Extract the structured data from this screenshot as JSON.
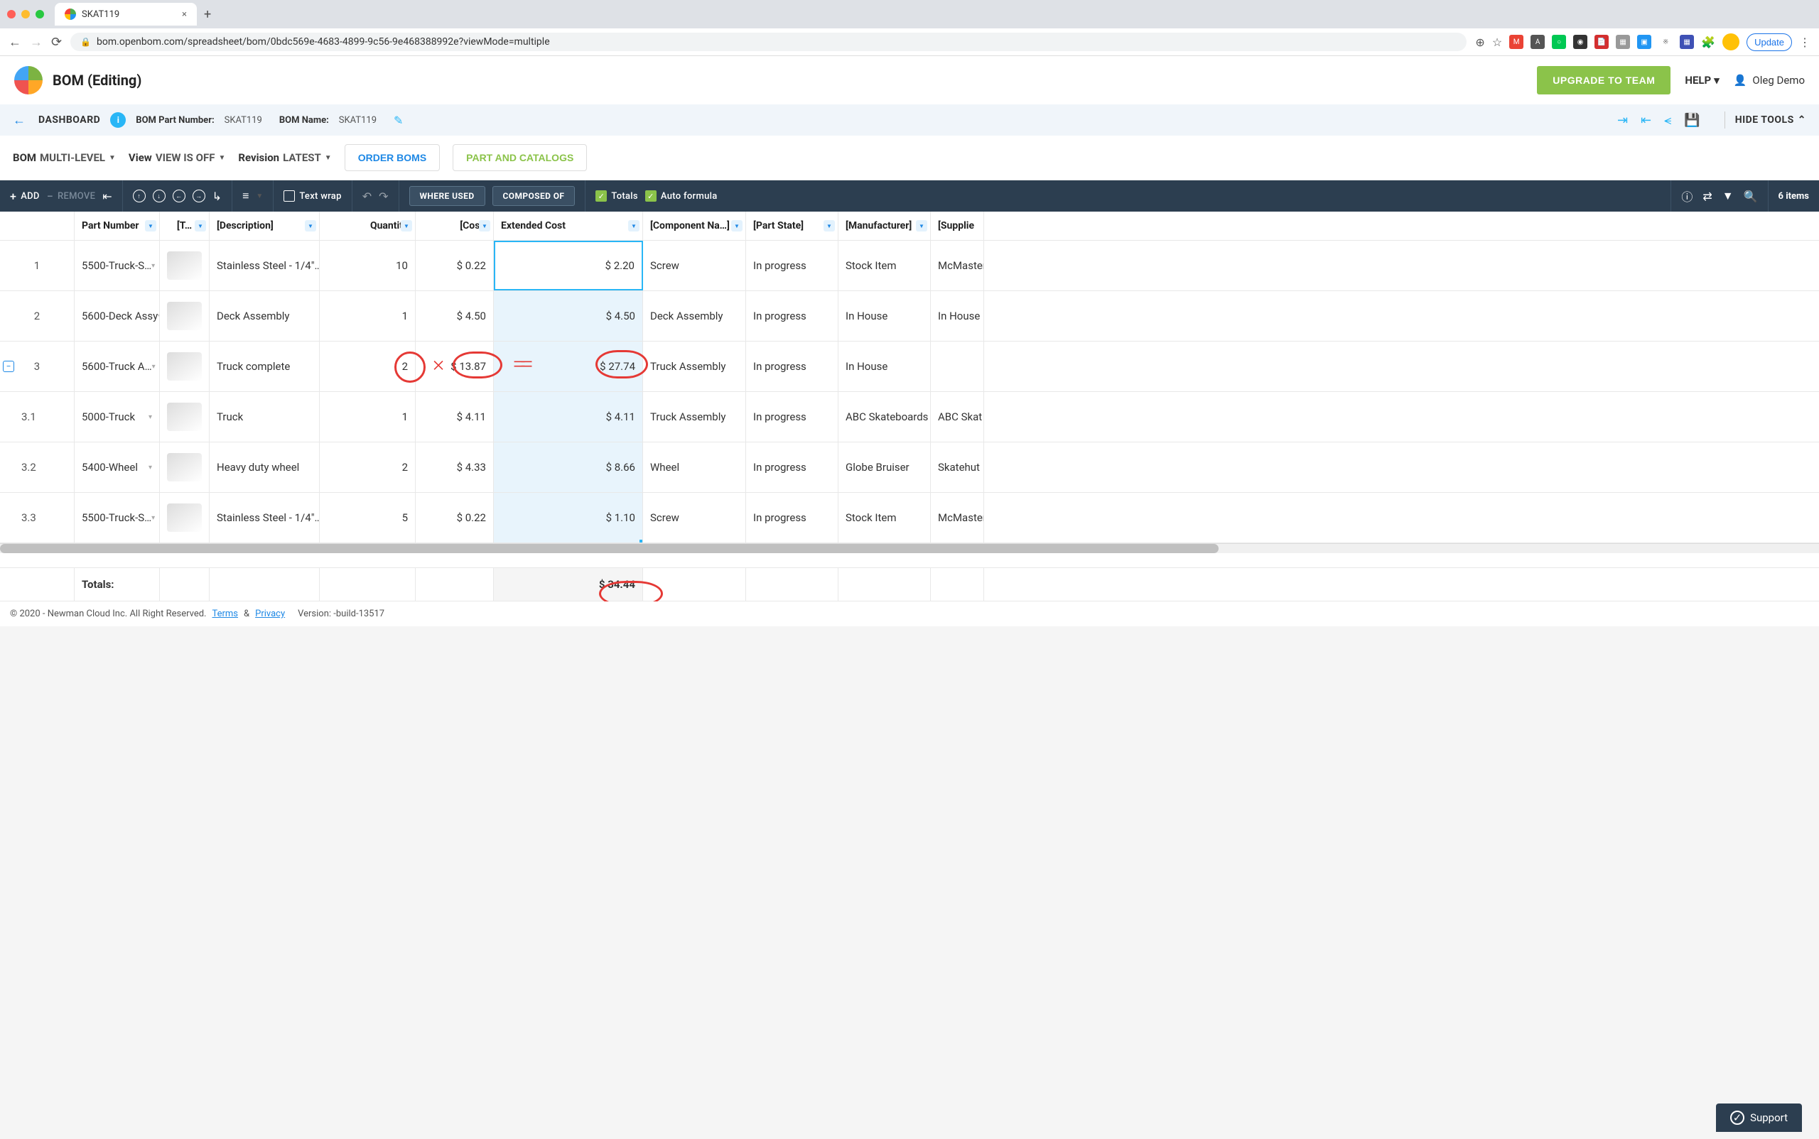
{
  "browser": {
    "tab_title": "SKAT119",
    "url": "bom.openbom.com/spreadsheet/bom/0bdc569e-4683-4899-9c56-9e468388992e?viewMode=multiple",
    "update_btn": "Update"
  },
  "header": {
    "title": "BOM (Editing)",
    "upgrade": "UPGRADE TO TEAM",
    "help": "HELP",
    "user": "Oleg Demo"
  },
  "subheader": {
    "dashboard": "DASHBOARD",
    "pn_label": "BOM Part Number:",
    "pn_val": "SKAT119",
    "name_label": "BOM Name:",
    "name_val": "SKAT119",
    "hide_tools": "HIDE TOOLS"
  },
  "viewbar": {
    "bom_label": "BOM",
    "bom_val": "MULTI-LEVEL",
    "view_label": "View",
    "view_val": "VIEW IS OFF",
    "rev_label": "Revision",
    "rev_val": "LATEST",
    "order_boms": "ORDER BOMS",
    "parts_cat": "PART AND CATALOGS"
  },
  "toolbar": {
    "add": "ADD",
    "remove": "REMOVE",
    "text_wrap": "Text wrap",
    "where_used": "WHERE USED",
    "composed_of": "COMPOSED OF",
    "totals": "Totals",
    "auto_formula": "Auto formula",
    "items": "6 items"
  },
  "columns": {
    "c1": "Part Number",
    "c2": "[T…",
    "c3": "[Description]",
    "c4": "Quantity",
    "c5": "[Cost]",
    "c6": "Extended Cost",
    "c7": "[Component Na…]",
    "c8": "[Part State]",
    "c9": "[Manufacturer]",
    "c10": "[Supplie"
  },
  "rows": [
    {
      "idx": "1",
      "pn": "5500-Truck-S…",
      "desc": "Stainless Steel - 1/4\"…",
      "qty": "10",
      "cost": "$ 0.22",
      "ext": "$ 2.20",
      "comp": "Screw",
      "state": "In progress",
      "mfr": "Stock Item",
      "supp": "McMaster"
    },
    {
      "idx": "2",
      "pn": "5600-Deck Assy",
      "desc": "Deck Assembly",
      "qty": "1",
      "cost": "$ 4.50",
      "ext": "$ 4.50",
      "comp": "Deck Assembly",
      "state": "In progress",
      "mfr": "In House",
      "supp": "In House"
    },
    {
      "idx": "3",
      "pn": "5600-Truck A…",
      "desc": "Truck complete",
      "qty": "2",
      "cost": "$ 13.87",
      "ext": "$ 27.74",
      "comp": "Truck Assembly",
      "state": "In progress",
      "mfr": "In House",
      "supp": ""
    },
    {
      "idx": "3.1",
      "pn": "5000-Truck",
      "desc": "Truck",
      "qty": "1",
      "cost": "$ 4.11",
      "ext": "$ 4.11",
      "comp": "Truck Assembly",
      "state": "In progress",
      "mfr": "ABC Skateboards",
      "supp": "ABC Skat"
    },
    {
      "idx": "3.2",
      "pn": "5400-Wheel",
      "desc": "Heavy duty wheel",
      "qty": "2",
      "cost": "$ 4.33",
      "ext": "$ 8.66",
      "comp": "Wheel",
      "state": "In progress",
      "mfr": "Globe Bruiser",
      "supp": "Skatehut"
    },
    {
      "idx": "3.3",
      "pn": "5500-Truck-S…",
      "desc": "Stainless Steel - 1/4\"…",
      "qty": "5",
      "cost": "$ 0.22",
      "ext": "$ 1.10",
      "comp": "Screw",
      "state": "In progress",
      "mfr": "Stock Item",
      "supp": "McMaster"
    }
  ],
  "totals": {
    "label": "Totals:",
    "ext": "$ 34.44"
  },
  "footer": {
    "copyright": "© 2020 - Newman Cloud Inc. All Right Reserved.",
    "terms": "Terms",
    "amp": "&",
    "privacy": "Privacy",
    "version": "Version: -build-13517",
    "support": "Support"
  }
}
